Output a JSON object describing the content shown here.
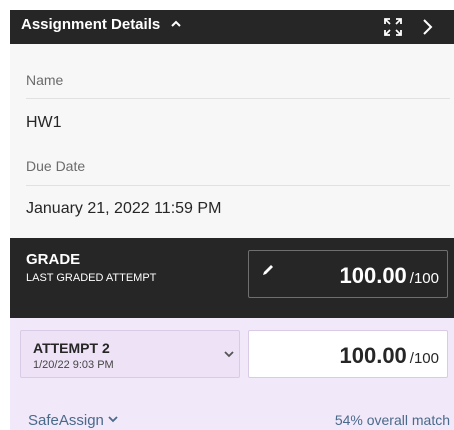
{
  "header": {
    "title": "Assignment Details",
    "collapse_icon": "chevron-up-icon",
    "expand_icon": "expand-icon",
    "next_icon": "chevron-right-icon"
  },
  "details": {
    "name_label": "Name",
    "name_value": "HW1",
    "due_label": "Due Date",
    "due_value": "January 21, 2022 11:59 PM"
  },
  "grade": {
    "title": "GRADE",
    "subtitle": "LAST GRADED ATTEMPT",
    "edit_icon": "pencil-icon",
    "score": "100.00",
    "max": "/100"
  },
  "attempt": {
    "title": "ATTEMPT 2",
    "date": "1/20/22 9:03 PM",
    "dropdown_icon": "chevron-down-icon",
    "score": "100.00",
    "max": "/100"
  },
  "safeassign": {
    "label": "SafeAssign",
    "match": "54% overall match"
  },
  "colors": {
    "dark_header": "#262626",
    "attempt_bg": "#f1e8f9",
    "link": "#4a6a8a"
  }
}
